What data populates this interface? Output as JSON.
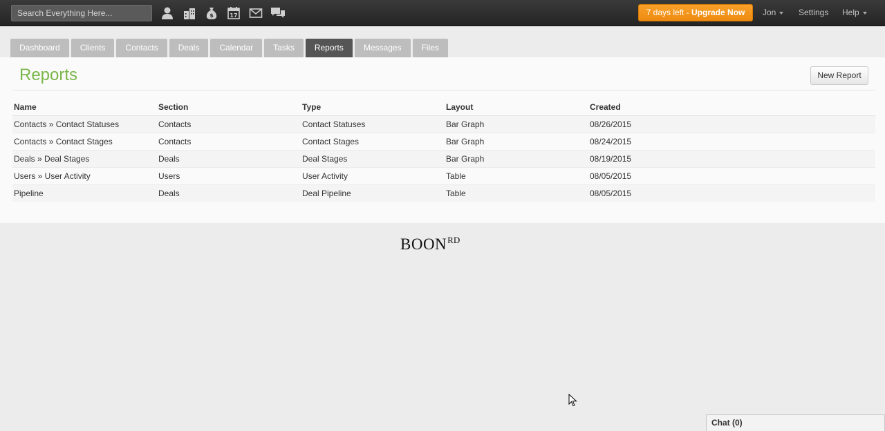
{
  "search": {
    "placeholder": "Search Everything Here..."
  },
  "toolbar_icons": [
    "person-icon",
    "buildings-icon",
    "money-bag-icon",
    "calendar-icon",
    "envelope-icon",
    "chat-bubbles-icon"
  ],
  "calendar_icon_day": "17",
  "upgrade": {
    "prefix": "7 days left - ",
    "strong": "Upgrade Now"
  },
  "user_menu": {
    "name": "Jon",
    "settings": "Settings",
    "help": "Help"
  },
  "tabs": [
    "Dashboard",
    "Clients",
    "Contacts",
    "Deals",
    "Calendar",
    "Tasks",
    "Reports",
    "Messages",
    "Files"
  ],
  "active_tab": "Reports",
  "page": {
    "title": "Reports",
    "new_button": "New Report"
  },
  "table": {
    "headers": [
      "Name",
      "Section",
      "Type",
      "Layout",
      "Created"
    ],
    "rows": [
      [
        "Contacts » Contact Statuses",
        "Contacts",
        "Contact Statuses",
        "Bar Graph",
        "08/26/2015"
      ],
      [
        "Contacts » Contact Stages",
        "Contacts",
        "Contact Stages",
        "Bar Graph",
        "08/24/2015"
      ],
      [
        "Deals » Deal Stages",
        "Deals",
        "Deal Stages",
        "Bar Graph",
        "08/19/2015"
      ],
      [
        "Users » User Activity",
        "Users",
        "User Activity",
        "Table",
        "08/05/2015"
      ],
      [
        "Pipeline",
        "Deals",
        "Deal Pipeline",
        "Table",
        "08/05/2015"
      ]
    ]
  },
  "footer": {
    "logo": "BOON",
    "logo_sup": "RD"
  },
  "chat": {
    "label": "Chat (0)"
  },
  "colors": {
    "accent_green": "#7ab648",
    "upgrade_orange": "#f39514",
    "topbar": "#2e2e2e"
  }
}
